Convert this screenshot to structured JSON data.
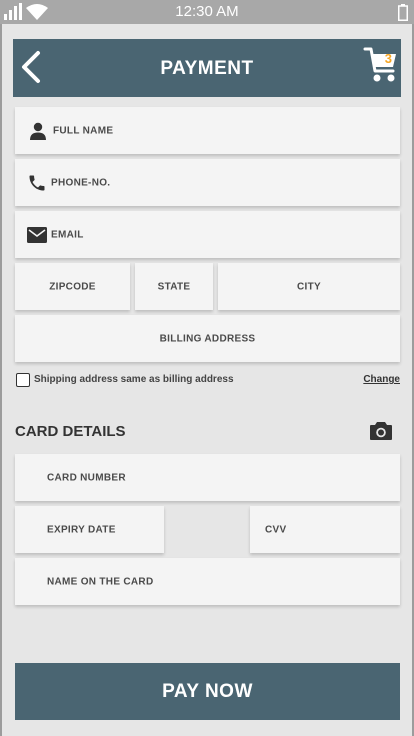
{
  "status_bar": {
    "time": "12:30 AM"
  },
  "header": {
    "title": "PAYMENT",
    "cart_count": "3"
  },
  "billing": {
    "full_name": "FULL NAME",
    "phone": "PHONE-NO.",
    "email": "EMAIL",
    "zipcode": "ZIPCODE",
    "state": "STATE",
    "city": "CITY",
    "address": "BILLING ADDRESS"
  },
  "shipping": {
    "same_as_billing_label": "Shipping address same as billing address",
    "same_as_billing_checked": false,
    "change_label": "Change"
  },
  "card": {
    "section_title": "CARD DETAILS",
    "number": "CARD NUMBER",
    "expiry": "EXPIRY DATE",
    "cvv": "CVV",
    "name": "NAME ON THE CARD"
  },
  "actions": {
    "pay_label": "PAY NOW"
  },
  "colors": {
    "primary": "#4a6572",
    "badge": "#f5a623",
    "field_bg": "#f4f4f4",
    "screen_bg": "#e6e6e6"
  },
  "icons": [
    "signal-icon",
    "wifi-icon",
    "battery-icon",
    "back-arrow-icon",
    "cart-icon",
    "person-icon",
    "phone-icon",
    "mail-icon",
    "camera-icon"
  ]
}
